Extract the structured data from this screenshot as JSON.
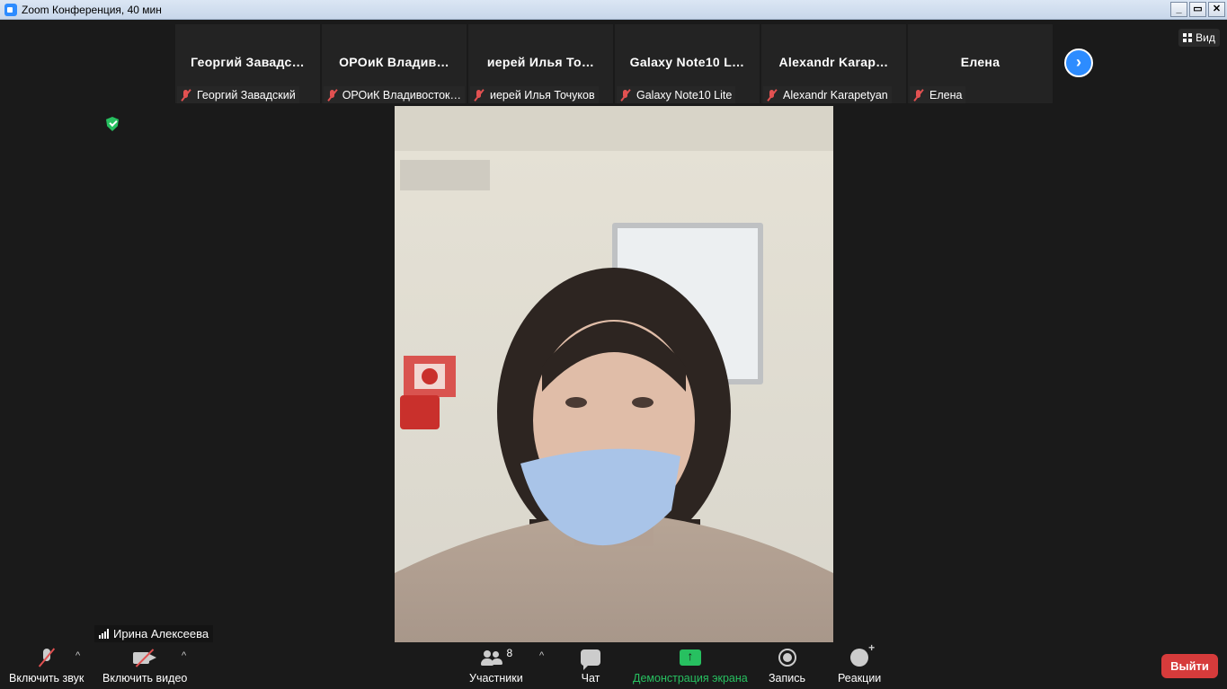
{
  "window": {
    "title": "Zoom Конференция, 40 мин",
    "minimize": "_",
    "maximize": "▭",
    "close": "✕"
  },
  "participants": [
    {
      "display": "Георгий  Завадс…",
      "label": "Георгий Завадский",
      "muted": true
    },
    {
      "display": "ОРОиК  Владив…",
      "label": "ОРОиК Владивосток…",
      "muted": true
    },
    {
      "display": "иерей  Илья  То…",
      "label": "иерей Илья Точуков",
      "muted": true
    },
    {
      "display": "Galaxy  Note10  L…",
      "label": "Galaxy Note10 Lite",
      "muted": true
    },
    {
      "display": "Alexandr  Karap…",
      "label": "Alexandr Karapetyan",
      "muted": true
    },
    {
      "display": "Елена",
      "label": "Елена",
      "muted": true
    }
  ],
  "view_button": {
    "label": "Вид"
  },
  "speaker": {
    "name": "Ирина Алексеева"
  },
  "toolbar": {
    "audio_label": "Включить звук",
    "video_label": "Включить видео",
    "participants_label": "Участники",
    "participants_count": "8",
    "chat_label": "Чат",
    "share_label": "Демонстрация экрана",
    "record_label": "Запись",
    "reactions_label": "Реакции",
    "exit_label": "Выйти",
    "caret": "^"
  },
  "colors": {
    "accent": "#2d8cff",
    "share_green": "#27c060",
    "exit_red": "#d63b3b",
    "muted_red": "#e25151"
  }
}
